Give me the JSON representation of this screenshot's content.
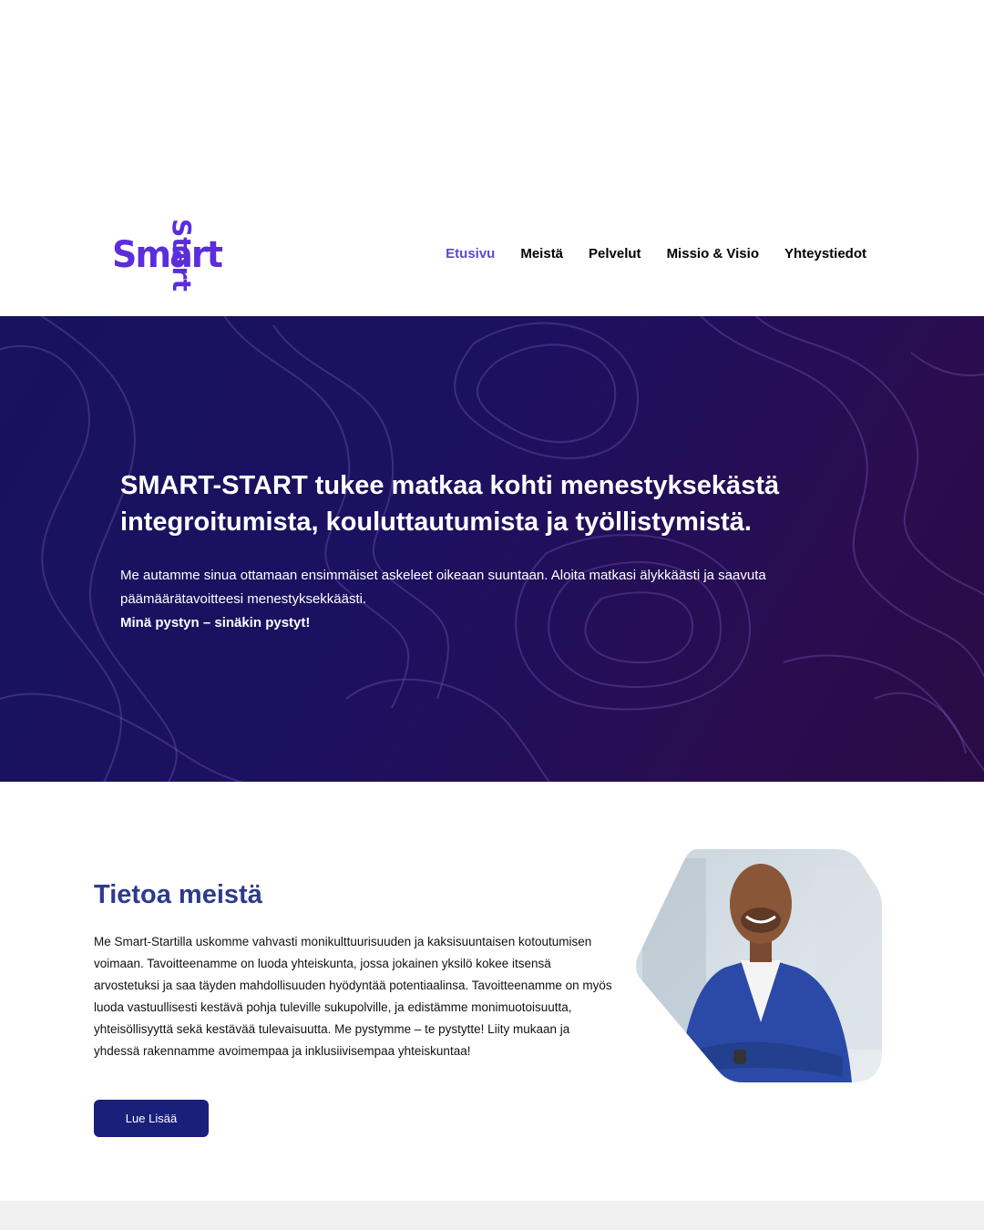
{
  "brand": {
    "logo_horizontal": "Smart",
    "logo_vertical": "Start",
    "logo_color": "#5b2ddc"
  },
  "nav": {
    "items": [
      {
        "label": "Etusivu",
        "active": true
      },
      {
        "label": "Meistä",
        "active": false
      },
      {
        "label": "Pelvelut",
        "active": false
      },
      {
        "label": "Missio & Visio",
        "active": false
      },
      {
        "label": "Yhteystiedot",
        "active": false
      }
    ],
    "active_color": "#5a4ad1"
  },
  "hero": {
    "title": "SMART-START tukee matkaa kohti menestyksekästä integroitumista, kouluttautumista ja työllistymistä.",
    "text": "Me autamme sinua ottamaan ensimmäiset askeleet oikeaan suuntaan. Aloita matkasi älykkäästi ja saavuta päämäärätavoitteesi menestyksekkäästi.",
    "strong": "Minä pystyn – sinäkin pystyt!",
    "background": "#1a1262"
  },
  "about": {
    "title": "Tietoa meistä",
    "title_color": "#2d3a8c",
    "text": "Me Smart-Startilla uskomme vahvasti monikulttuurisuuden ja kaksisuuntaisen kotoutumisen voimaan. Tavoitteenamme on luoda yhteiskunta, jossa jokainen yksilö kokee itsensä arvostetuksi ja saa täyden mahdollisuuden hyödyntää potentiaalinsa. Tavoitteenamme on myös luoda vastuullisesti kestävä pohja tuleville sukupolville, ja edistämme monimuotoisuutta, yhteisöllisyyttä sekä kestävää tulevaisuutta. Me pystymme – te pystytte! Liity mukaan ja yhdessä rakennamme avoimempaa ja inklusiivisempaa yhteiskuntaa!",
    "button_label": "Lue Lisää",
    "button_color": "#1a1f7a"
  }
}
